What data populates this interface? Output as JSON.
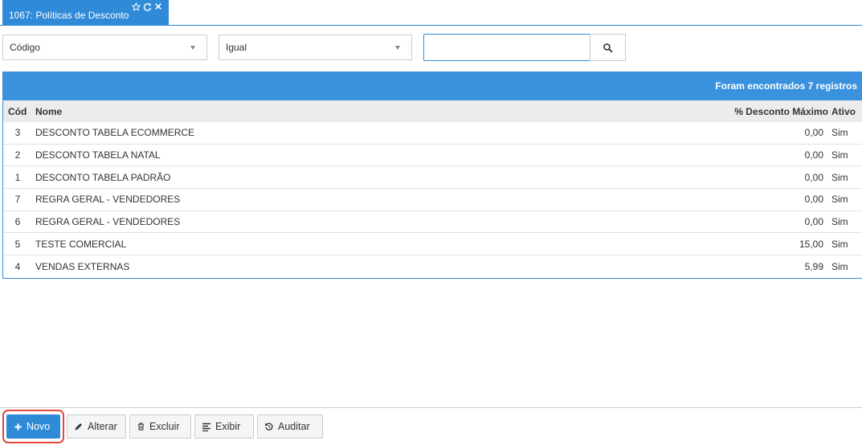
{
  "tab": {
    "title": "1067: Políticas de Desconto"
  },
  "filters": {
    "field_select": "Código",
    "operator_select": "Igual",
    "search_value": ""
  },
  "grid": {
    "summary": "Foram encontrados 7 registros",
    "columns": {
      "cod": "Cód",
      "nome": "Nome",
      "desconto": "% Desconto Máximo",
      "ativo": "Ativo"
    },
    "rows": [
      {
        "cod": "3",
        "nome": "DESCONTO TABELA ECOMMERCE",
        "desconto": "0,00",
        "ativo": "Sim"
      },
      {
        "cod": "2",
        "nome": "DESCONTO TABELA NATAL",
        "desconto": "0,00",
        "ativo": "Sim"
      },
      {
        "cod": "1",
        "nome": "DESCONTO TABELA PADRÃO",
        "desconto": "0,00",
        "ativo": "Sim"
      },
      {
        "cod": "7",
        "nome": "REGRA GERAL - VENDEDORES",
        "desconto": "0,00",
        "ativo": "Sim"
      },
      {
        "cod": "6",
        "nome": "REGRA GERAL - VENDEDORES",
        "desconto": "0,00",
        "ativo": "Sim"
      },
      {
        "cod": "5",
        "nome": "TESTE COMERCIAL",
        "desconto": "15,00",
        "ativo": "Sim"
      },
      {
        "cod": "4",
        "nome": "VENDAS EXTERNAS",
        "desconto": "5,99",
        "ativo": "Sim"
      }
    ]
  },
  "toolbar": {
    "novo": "Novo",
    "alterar": "Alterar",
    "excluir": "Excluir",
    "exibir": "Exibir",
    "auditar": "Auditar"
  },
  "colors": {
    "accent": "#2f8ad8",
    "highlight": "#e0473e"
  }
}
